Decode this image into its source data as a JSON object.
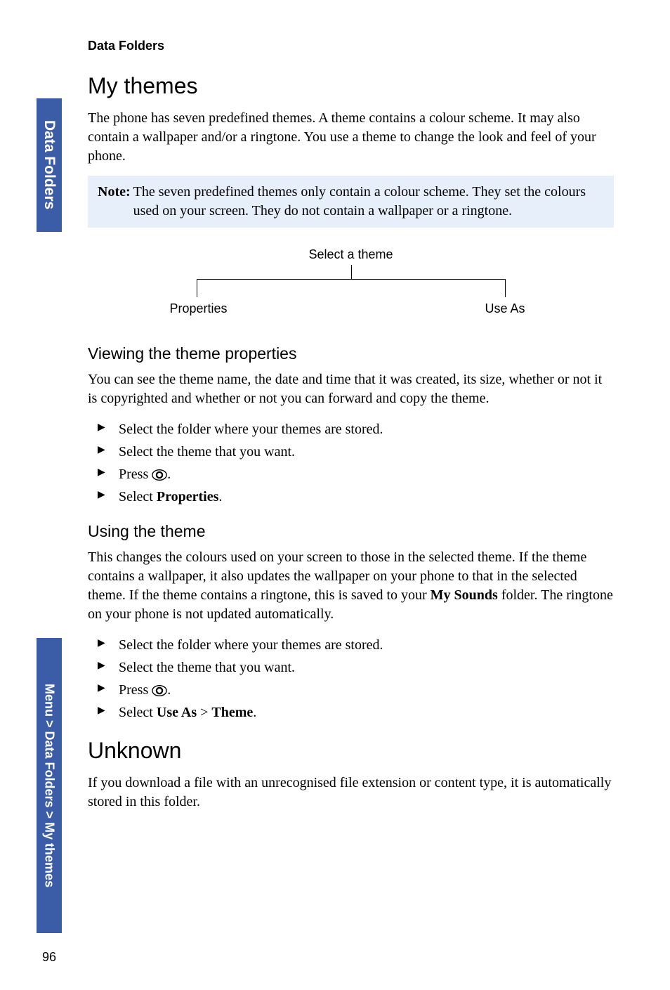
{
  "running_head": "Data Folders",
  "side_tab_1": "Data Folders",
  "side_tab_2": "Menu > Data Folders > My themes",
  "page_number": "96",
  "section1": {
    "title": "My themes",
    "para1": "The phone has seven predefined themes. A theme contains a colour scheme. It may also contain a wallpaper and/or a ringtone. You use a theme to change the look and feel of your phone.",
    "note_label": "Note:",
    "note_text": "The seven predefined themes only contain a colour scheme. They set the colours used on your screen. They do not contain a wallpaper or a ringtone.",
    "diagram": {
      "top": "Select a theme",
      "left": "Properties",
      "right": "Use As"
    },
    "sub1": {
      "title": "Viewing the theme properties",
      "para": "You can see the theme name, the date and time that it was created, its size, whether or not it is copyrighted and whether or not you can forward and copy the theme.",
      "steps": {
        "s1": "Select the folder where your themes are stored.",
        "s2": "Select the theme that you want.",
        "s3_pre": "Press ",
        "s3_post": ".",
        "s4_pre": "Select ",
        "s4_bold": "Properties",
        "s4_post": "."
      }
    },
    "sub2": {
      "title": "Using the theme",
      "para_pre": "This changes the colours used on your screen to those in the selected theme. If the theme contains a wallpaper, it also updates the wallpaper on your phone to that in the selected theme. If the theme contains a ringtone, this is saved to your ",
      "para_bold": "My Sounds",
      "para_post": " folder. The ringtone on your phone is not updated automatically.",
      "steps": {
        "s1": "Select the folder where your themes are stored.",
        "s2": "Select the theme that you want.",
        "s3_pre": "Press ",
        "s3_post": ".",
        "s4_pre": "Select ",
        "s4_b1": "Use As",
        "s4_mid": " > ",
        "s4_b2": "Theme",
        "s4_post": "."
      }
    }
  },
  "section2": {
    "title": "Unknown",
    "para": "If you download a file with an unrecognised file extension or content type, it is automatically stored in this folder."
  }
}
